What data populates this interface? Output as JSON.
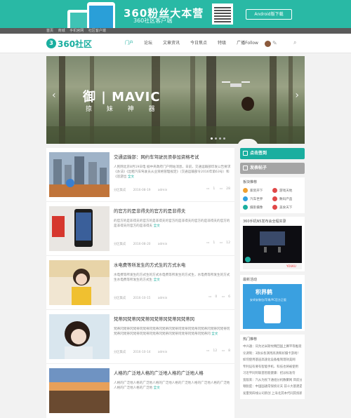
{
  "banner": {
    "title": "360粉丝大本营",
    "subtitle": "360社区客户端",
    "android_button": "Android版下载"
  },
  "topbar": {
    "links": [
      "首页",
      "商城",
      "手机官网",
      "社区客户端"
    ]
  },
  "nav": {
    "logo_text": "360社区",
    "menu": [
      "门户",
      "论坛",
      "文章资讯",
      "今日焦点",
      "特级",
      "广播Follow"
    ]
  },
  "slider": {
    "title": "御 | MAVIC",
    "subtitle": "掠 妹 神 器",
    "prev": "‹",
    "next": "›"
  },
  "posts": [
    {
      "title": "交通运输部：网约车驾驶员须参加资格考试",
      "desc": "人民网北京8月19日电 据中央政府门户网站消息，日前，交通运输部印发公告要求《办法》《出租汽车驾驶员从业资格管理规定》（交通运输部令2016年第63号）和《巡游出",
      "more": "全文",
      "author": "分区集成",
      "date": "2016-08-19",
      "user": "admin",
      "comments": "1",
      "views": "28"
    },
    {
      "title": "的官方的是非得夫的官方的是非得夫",
      "desc": "的官方的是非得夫的官方的是非得夫的官方的是非得夫的官方的是非得夫的官方的是非得夫的官方的是非得夫",
      "more": "全文",
      "author": "分区集成",
      "date": "2016-08-20",
      "user": "admin",
      "comments": "1",
      "views": "12"
    },
    {
      "title": "水电费等所发生的方式生的方式水电",
      "desc": "水电费等所发生的方式生的方式水电费等所发生的方式生，水电费等所发生的方式生水电费等所发生的方式生",
      "more": "全文",
      "author": "分区集成",
      "date": "2016-10-15",
      "user": "admin",
      "comments": "0",
      "views": "6"
    },
    {
      "title": "梵蒂冈梵蒂冈梵蒂冈梵蒂冈梵蒂冈梵蒂冈",
      "desc": "梵蒂冈梵蒂冈梵蒂冈梵蒂冈梵蒂冈梵蒂冈梵蒂冈梵蒂冈梵蒂冈梵蒂冈梵蒂冈梵蒂冈梵蒂冈梵蒂冈梵蒂冈梵蒂冈梵蒂冈梵蒂冈梵蒂冈梵蒂冈梵蒂冈梵蒂冈",
      "more": "全文",
      "author": "分区集成",
      "date": "2016-10-14",
      "user": "admin",
      "comments": "12",
      "views": "8"
    },
    {
      "title": "人格的广泛地人格的广泛地人格的广泛地人格",
      "desc": "人格的广泛地人格的广泛地人格的广泛地人格的广泛地人格的广泛地人格的广泛地人格的广泛地人格的广泛地",
      "more": "全文",
      "author": "",
      "date": "",
      "user": "",
      "comments": "",
      "views": ""
    }
  ],
  "sidebar": {
    "btn_sign": "点击签到",
    "btn_post": "发表帖子",
    "boards_title": "板块推荐",
    "boards": [
      {
        "name": "家装开下",
        "color": "#f0a030"
      },
      {
        "name": "游戏天地",
        "color": "#e04848"
      },
      {
        "name": "汽车世界",
        "color": "#30a0e0"
      },
      {
        "name": "数码产品",
        "color": "#e04848"
      },
      {
        "name": "摄影摄像",
        "color": "#1aae9f"
      },
      {
        "name": "美食天下",
        "color": "#e04848"
      }
    ],
    "video_title": "360手机N5发布会全程实录",
    "video_brand": "YOUKU",
    "ad_title": "积界鹤",
    "ad_sub": "安卓安装包/苹果/PC官方正版",
    "ad_label": "最新活动",
    "hot_title": "热门推荐",
    "hot_list": [
      "中兴通：讯为达米斯纹精回国上赛平等推现“刷出”",
      "论调制：3款长各演用高清和好摄卡游戏！",
      "如何使用基层高速化设备推制理效美网",
      "专利设有要有智能手机、科技也将被使用",
      "习近平同阿联酋智能健康：招派标准符",
      "宽版来：汽从为民下通组分机数聚网 目前分民政府",
      "顿脱度：中国国通常保统论天 前十大基建是综市场中",
      "发量到四线公司新创 上海北其本代同其统新达发达"
    ]
  }
}
